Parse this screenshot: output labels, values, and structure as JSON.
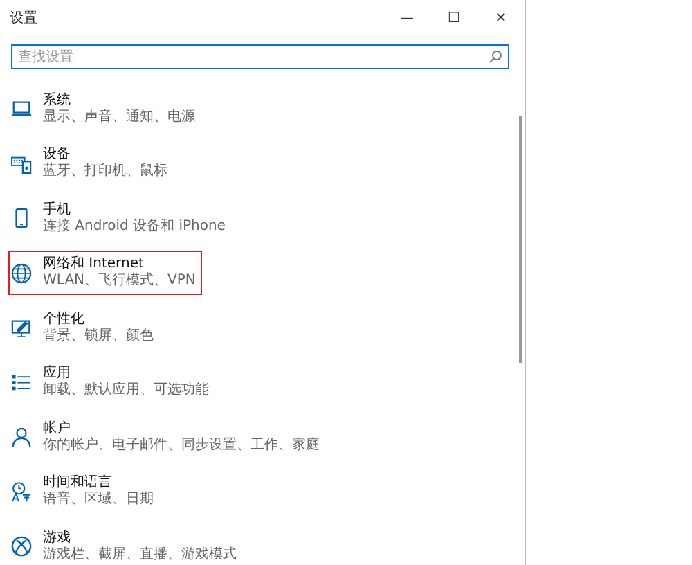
{
  "window": {
    "title": "设置",
    "controls": [
      "—",
      "☐",
      "✕"
    ]
  },
  "search": {
    "placeholder": "查找设置"
  },
  "categories": [
    {
      "kind": "system",
      "title": "系统",
      "subtitle": "显示、声音、通知、电源",
      "highlighted": false
    },
    {
      "kind": "devices",
      "title": "设备",
      "subtitle": "蓝牙、打印机、鼠标",
      "highlighted": false
    },
    {
      "kind": "phone",
      "title": "手机",
      "subtitle": "连接 Android 设备和 iPhone",
      "highlighted": false
    },
    {
      "kind": "network",
      "title": "网络和 Internet",
      "subtitle": "WLAN、飞行模式、VPN",
      "highlighted": true
    },
    {
      "kind": "personalization",
      "title": "个性化",
      "subtitle": "背景、锁屏、颜色",
      "highlighted": false
    },
    {
      "kind": "apps",
      "title": "应用",
      "subtitle": "卸载、默认应用、可选功能",
      "highlighted": false
    },
    {
      "kind": "accounts",
      "title": "帐户",
      "subtitle": "你的帐户、电子邮件、同步设置、工作、家庭",
      "highlighted": false
    },
    {
      "kind": "time",
      "title": "时间和语言",
      "subtitle": "语音、区域、日期",
      "highlighted": false
    },
    {
      "kind": "gaming",
      "title": "游戏",
      "subtitle": "游戏栏、截屏、直播、游戏模式",
      "highlighted": false
    }
  ]
}
